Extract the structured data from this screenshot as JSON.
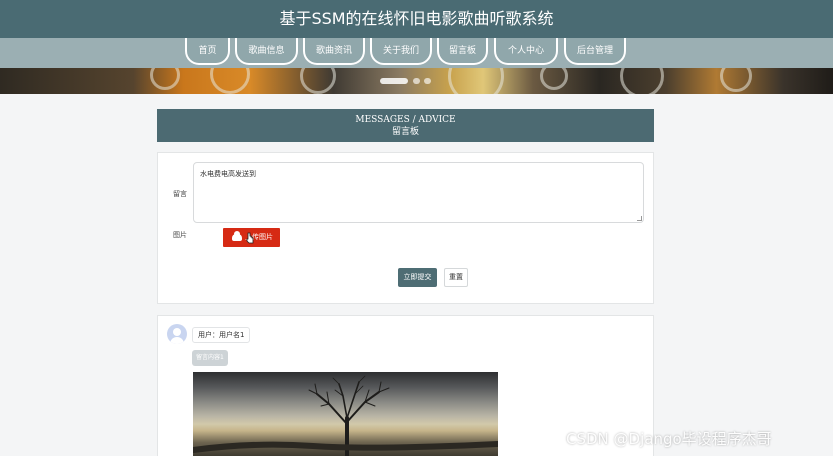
{
  "header": {
    "title": "基于SSM的在线怀旧电影歌曲听歌系统"
  },
  "nav": {
    "items": [
      "首页",
      "歌曲信息",
      "歌曲资讯",
      "关于我们",
      "留言板",
      "个人中心",
      "后台管理"
    ]
  },
  "section": {
    "title_en": "MESSAGES / ADVICE",
    "title_cn": "留言板"
  },
  "form": {
    "message_label": "留言",
    "message_value": "水电费电高发送到",
    "image_label": "图片",
    "upload_label": "上传图片",
    "submit_label": "立即提交",
    "reset_label": "重置"
  },
  "messages": [
    {
      "user": "用户：用户名1",
      "content": "留言内容1"
    }
  ],
  "watermark": "CSDN @Django毕设程序杰哥",
  "colors": {
    "header": "#4a6b73",
    "nav": "#9bafb3",
    "title_bar": "#4c6a72",
    "upload": "#d62a14",
    "submit": "#4e6d74"
  }
}
